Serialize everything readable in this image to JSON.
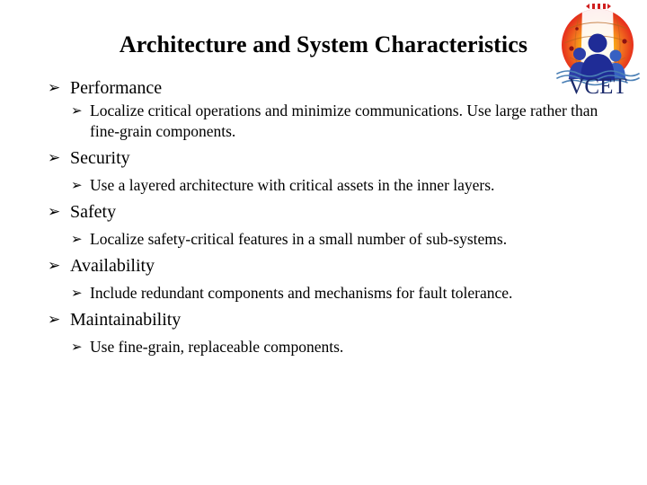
{
  "slide": {
    "title": "Architecture and System Characteristics",
    "bullet_glyph": "➢",
    "background_color": "#ffffff",
    "text_color": "#000000"
  },
  "logo": {
    "name": "vcet-logo",
    "wordmark": "VCET",
    "colors": {
      "outer_red": "#e8271c",
      "mid_orange": "#f47a1f",
      "inner_yellow": "#f9c00c",
      "figure_blue": "#1f2c96",
      "figure_blue_light": "#2f5fc0",
      "wave_blue": "#4a7fb5",
      "wordmark_navy": "#1b2a6b",
      "crown_red": "#cf1f1f"
    }
  },
  "content": {
    "items": [
      {
        "label": "Performance",
        "subitems": [
          "Localize critical operations and minimize communications. Use large rather than fine-grain components."
        ]
      },
      {
        "label": "Security",
        "subitems": [
          "Use a layered architecture with critical assets in the inner layers."
        ]
      },
      {
        "label": "Safety",
        "subitems": [
          "Localize safety-critical features in a small number of sub-systems."
        ]
      },
      {
        "label": "Availability",
        "subitems": [
          "Include redundant components and mechanisms for fault tolerance."
        ]
      },
      {
        "label": "Maintainability",
        "subitems": [
          "Use fine-grain, replaceable components."
        ]
      }
    ]
  }
}
